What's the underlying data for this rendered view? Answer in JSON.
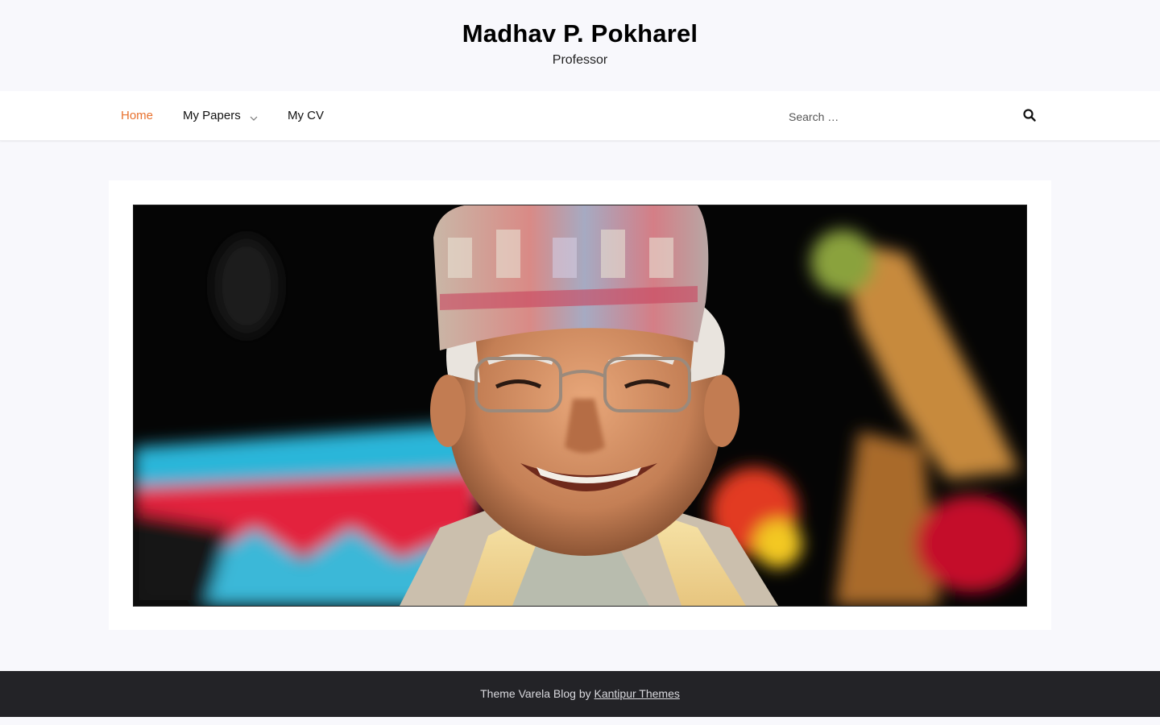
{
  "site": {
    "title": "Madhav P. Pokharel",
    "tagline": "Professor"
  },
  "nav": {
    "items": [
      {
        "label": "Home",
        "active": true
      },
      {
        "label": "My Papers",
        "has_submenu": true
      },
      {
        "label": "My CV"
      }
    ],
    "accent_color": "#e8712e"
  },
  "search": {
    "placeholder": "Search …",
    "value": "",
    "icon": "search-icon"
  },
  "hero": {
    "subject": "portrait photo",
    "icon": "portrait-photo"
  },
  "footer": {
    "prefix": "Theme Varela Blog by ",
    "link_label": "Kantipur Themes"
  }
}
